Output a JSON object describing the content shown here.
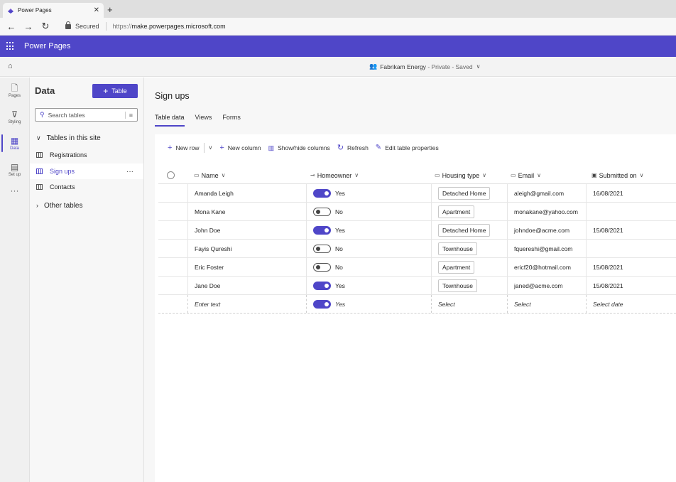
{
  "browser": {
    "tab_title": "Power Pages",
    "address_security": "Secured",
    "url_scheme": "https://",
    "url_host": "make.powerpages.microsoft.com"
  },
  "app": {
    "name": "Power Pages",
    "accent": "#4f46c8"
  },
  "site": {
    "name": "Fabrikam Energy",
    "status": "- Private - Saved"
  },
  "rail": [
    {
      "label": "Pages",
      "icon": "page-icon"
    },
    {
      "label": "Styling",
      "icon": "brush-icon"
    },
    {
      "label": "Data",
      "icon": "table-grid-icon"
    },
    {
      "label": "Set up",
      "icon": "setup-icon"
    }
  ],
  "panel": {
    "title": "Data",
    "add_table_label": "Table",
    "search_placeholder": "Search tables",
    "group_site": "Tables in this site",
    "tables": [
      "Registrations",
      "Sign ups",
      "Contacts"
    ],
    "active_table": "Sign ups",
    "group_other": "Other tables"
  },
  "main": {
    "title": "Sign ups",
    "tabs": [
      "Table data",
      "Views",
      "Forms"
    ],
    "active_tab": "Table data",
    "toolbar": {
      "new_row": "New row",
      "new_column": "New column",
      "show_hide": "Show/hide columns",
      "refresh": "Refresh",
      "edit_props": "Edit table properties"
    },
    "columns": [
      "Name",
      "Homeowner",
      "Housing type",
      "Email",
      "Submitted on"
    ],
    "rows": [
      {
        "name": "Amanda Leigh",
        "homeowner": "Yes",
        "housing": "Detached Home",
        "email": "aleigh@gmail.com",
        "submitted": "16/08/2021"
      },
      {
        "name": "Mona Kane",
        "homeowner": "No",
        "housing": "Apartment",
        "email": "monakane@yahoo.com",
        "submitted": ""
      },
      {
        "name": "John Doe",
        "homeowner": "Yes",
        "housing": "Detached Home",
        "email": "johndoe@acme.com",
        "submitted": "15/08/2021"
      },
      {
        "name": "Fayis Qureshi",
        "homeowner": "No",
        "housing": "Townhouse",
        "email": "fquereshi@gmail.com",
        "submitted": ""
      },
      {
        "name": "Eric Foster",
        "homeowner": "No",
        "housing": "Apartment",
        "email": "ericf20@hotmail.com",
        "submitted": "15/08/2021"
      },
      {
        "name": "Jane Doe",
        "homeowner": "Yes",
        "housing": "Townhouse",
        "email": "janed@acme.com",
        "submitted": "15/08/2021"
      }
    ],
    "new_row": {
      "name": "Enter text",
      "homeowner": "Yes",
      "housing": "Select",
      "email": "Select",
      "submitted": "Select date"
    }
  }
}
